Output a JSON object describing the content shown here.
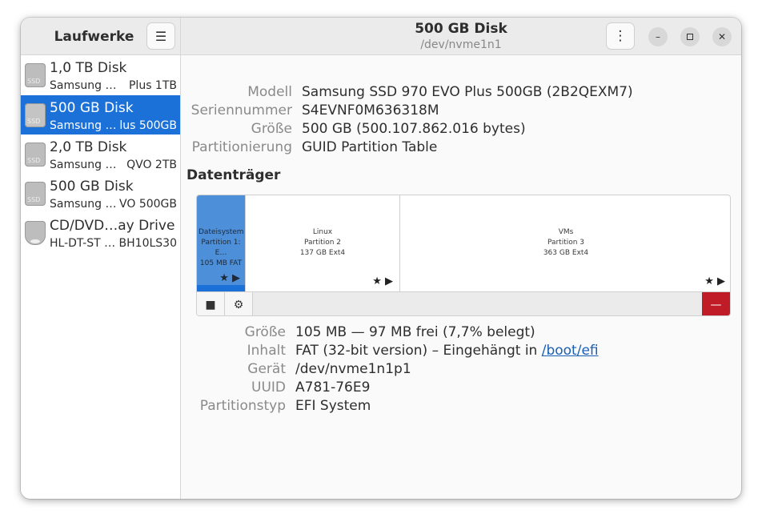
{
  "sidebar": {
    "title": "Laufwerke",
    "drives": [
      {
        "name": "1,0 TB Disk",
        "vendor": "Samsung …",
        "model": "Plus 1TB",
        "icon": "ssd-icon",
        "icon_label": "SSD"
      },
      {
        "name": "500 GB Disk",
        "vendor": "Samsung …",
        "model": "lus 500GB",
        "icon": "ssd-icon",
        "icon_label": "SSD",
        "selected": true
      },
      {
        "name": "2,0 TB Disk",
        "vendor": "Samsung …",
        "model": "QVO 2TB",
        "icon": "ssd-icon",
        "icon_label": "SSD"
      },
      {
        "name": "500 GB Disk",
        "vendor": "Samsung …",
        "model": "VO 500GB",
        "icon": "ssd-icon",
        "icon_label": "SSD"
      },
      {
        "name": "CD/DVD…ay Drive",
        "vendor": "HL-DT-ST …",
        "model": "BH10LS30",
        "icon": "optical-drive-icon"
      }
    ]
  },
  "header": {
    "title": "500 GB Disk",
    "subtitle": "/dev/nvme1n1"
  },
  "disk_info": [
    {
      "label": "Modell",
      "value": "Samsung SSD 970 EVO Plus 500GB (2B2QEXM7)"
    },
    {
      "label": "Seriennummer",
      "value": "S4EVNF0M636318M"
    },
    {
      "label": "Größe",
      "value": "500 GB (500.107.862.016 bytes)"
    },
    {
      "label": "Partitionierung",
      "value": "GUID Partition Table"
    }
  ],
  "volumes_title": "Datenträger",
  "partitions": [
    {
      "line1": "Dateisystem",
      "line2": "Partition 1: E…",
      "line3": "105 MB FAT",
      "selected": true
    },
    {
      "line1": "Linux",
      "line2": "Partition 2",
      "line3": "137 GB Ext4"
    },
    {
      "line1": "VMs",
      "line2": "Partition 3",
      "line3": "363 GB Ext4"
    }
  ],
  "partition_details": {
    "size_label": "Größe",
    "size_value": "105 MB — 97 MB frei (7,7% belegt)",
    "content_label": "Inhalt",
    "content_value": "FAT (32-bit version) – Eingehängt in",
    "content_link": "/boot/efi",
    "device_label": "Gerät",
    "device_value": "/dev/nvme1n1p1",
    "uuid_label": "UUID",
    "uuid_value": "A781-76E9",
    "type_label": "Partitionstyp",
    "type_value": "EFI System"
  },
  "colors": {
    "selection": "#1c71d8",
    "partition_selected": "#4d8fd8",
    "delete_button": "#c01c28",
    "link": "#1a5fb4"
  }
}
